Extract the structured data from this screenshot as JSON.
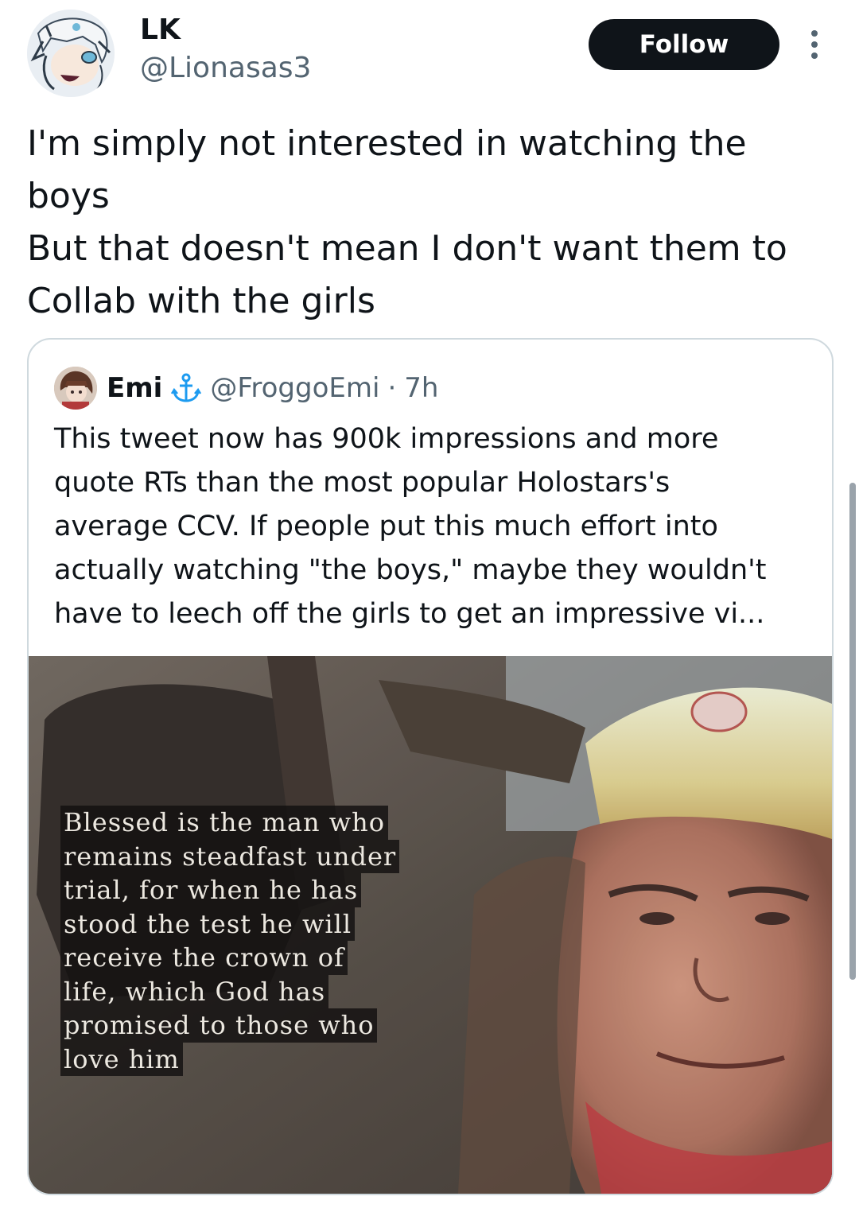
{
  "author": {
    "display_name": "LK",
    "handle": "@Lionasas3",
    "avatar_icon": "anime-character-avatar-icon"
  },
  "follow_label": "Follow",
  "tweet": {
    "lines": [
      "I'm simply not interested in watching the",
      "boys",
      "But that doesn't mean I don't want them to",
      "Collab with the girls"
    ]
  },
  "quote": {
    "display_name": "Emi",
    "name_badge_icon": "anchor-icon",
    "handle": "@FroggoEmi",
    "separator": "·",
    "time": "7h",
    "lines": [
      "This tweet now has 900k impressions and  more",
      "quote RTs than the most popular Holostars's",
      "average CCV. If people put this much effort into",
      "actually watching \"the boys,\" maybe they wouldn't",
      "have to leech off the girls to get an impressive vi..."
    ],
    "image": {
      "caption_lines": [
        "Blessed is the man who",
        "remains steadfast under",
        "trial, for when he has",
        "stood the test he will",
        "receive the crown of",
        "life, which God has",
        "promised to those who",
        "love him"
      ]
    }
  },
  "colors": {
    "text": "#0f1419",
    "secondary": "#536471",
    "border": "#cfd9de",
    "follow_bg": "#0f1419",
    "anchor": "#1d9bf0"
  }
}
